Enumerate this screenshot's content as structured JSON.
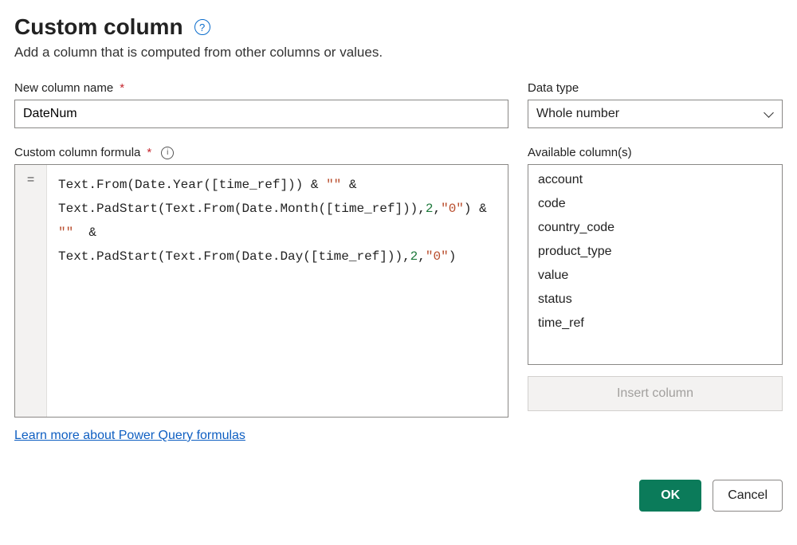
{
  "header": {
    "title": "Custom column",
    "subtitle": "Add a column that is computed from other columns or values."
  },
  "fields": {
    "name_label": "New column name",
    "name_value": "DateNum",
    "datatype_label": "Data type",
    "datatype_value": "Whole number",
    "formula_label": "Custom column formula",
    "available_label": "Available column(s)"
  },
  "formula": {
    "equals": "=",
    "tokens": [
      {
        "t": "plain",
        "v": "Text.From(Date.Year([time_ref])) & "
      },
      {
        "t": "str",
        "v": "\"\""
      },
      {
        "t": "plain",
        "v": " & Text.PadStart(Text.From(Date.Month([time_ref])),"
      },
      {
        "t": "num",
        "v": "2"
      },
      {
        "t": "plain",
        "v": ","
      },
      {
        "t": "str",
        "v": "\"0\""
      },
      {
        "t": "plain",
        "v": ") & "
      },
      {
        "t": "str",
        "v": "\"\""
      },
      {
        "t": "plain",
        "v": "  &  Text.PadStart(Text.From(Date.Day([time_ref])),"
      },
      {
        "t": "num",
        "v": "2"
      },
      {
        "t": "plain",
        "v": ","
      },
      {
        "t": "str",
        "v": "\"0\""
      },
      {
        "t": "plain",
        "v": ")"
      }
    ]
  },
  "available_columns": [
    "account",
    "code",
    "country_code",
    "product_type",
    "value",
    "status",
    "time_ref"
  ],
  "buttons": {
    "insert": "Insert column",
    "ok": "OK",
    "cancel": "Cancel"
  },
  "link": {
    "learn_more": "Learn more about Power Query formulas"
  }
}
